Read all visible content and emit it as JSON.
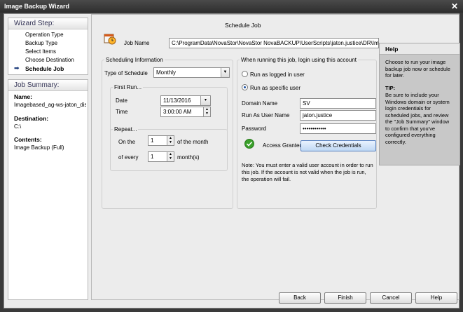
{
  "window": {
    "title": "Image Backup Wizard",
    "close_glyph": "✕"
  },
  "wizard_steps": {
    "heading": "Wizard Step:",
    "items": [
      {
        "label": "Operation Type"
      },
      {
        "label": "Backup Type"
      },
      {
        "label": "Select Items"
      },
      {
        "label": "Choose Destination"
      },
      {
        "label": "Schedule Job"
      }
    ],
    "active_index": 4
  },
  "job_summary": {
    "heading": "Job Summary:",
    "name_label": "Name:",
    "name_value": "Imagebased_ag-ws-jaton_disk",
    "destination_label": "Destination:",
    "destination_value": "C:\\",
    "contents_label": "Contents:",
    "contents_value": "Image Backup (Full)"
  },
  "main": {
    "title": "Schedule Job",
    "job_name_label": "Job Name",
    "job_name_value": "C:\\ProgramData\\NovaStor\\NovaStor NovaBACKUP\\UserScripts\\jaton.justice\\DR\\Imagebased",
    "icon": "calendar-clock-icon"
  },
  "scheduling": {
    "group_title": "Scheduling Information",
    "type_label": "Type of Schedule",
    "type_value": "Monthly",
    "first_run": {
      "title": "First Run...",
      "date_label": "Date",
      "date_value": "11/13/2016",
      "time_label": "Time",
      "time_value": "3:00:00 AM"
    },
    "repeat": {
      "title": "Repeat...",
      "on_the_label": "On the",
      "on_the_value": "1",
      "on_the_suffix": "of the month",
      "every_label": "of every",
      "every_value": "1",
      "every_suffix": "month(s)"
    }
  },
  "account": {
    "group_title": "When running this job, login using this account",
    "option_logged_in": "Run as logged in user",
    "option_specific": "Run as specific user",
    "selected": "specific",
    "domain_label": "Domain Name",
    "domain_value": "SV",
    "user_label": "Run As User Name",
    "user_value": "jaton.justice",
    "password_label": "Password",
    "password_value": "••••••••••••",
    "status_text": "Access Granted",
    "check_button": "Check Credentials",
    "note": "Note: You must enter a valid user account in order to run this job. If the account is not valid when the job is run, the operation will fail."
  },
  "help": {
    "heading": "Help",
    "body": "Choose to run your image backup job now or schedule for later.",
    "tip_heading": "TIP:",
    "tip_body": "Be sure to include your Windows domain or system login credentials for scheduled jobs, and review the \"Job Summary\" window to confirm that you've configured everything correctly."
  },
  "footer": {
    "back": "Back",
    "finish": "Finish",
    "cancel": "Cancel",
    "help": "Help"
  },
  "colors": {
    "accent": "#1b4fa0",
    "success": "#3aa02a",
    "help_bg": "#c8c8c8"
  }
}
